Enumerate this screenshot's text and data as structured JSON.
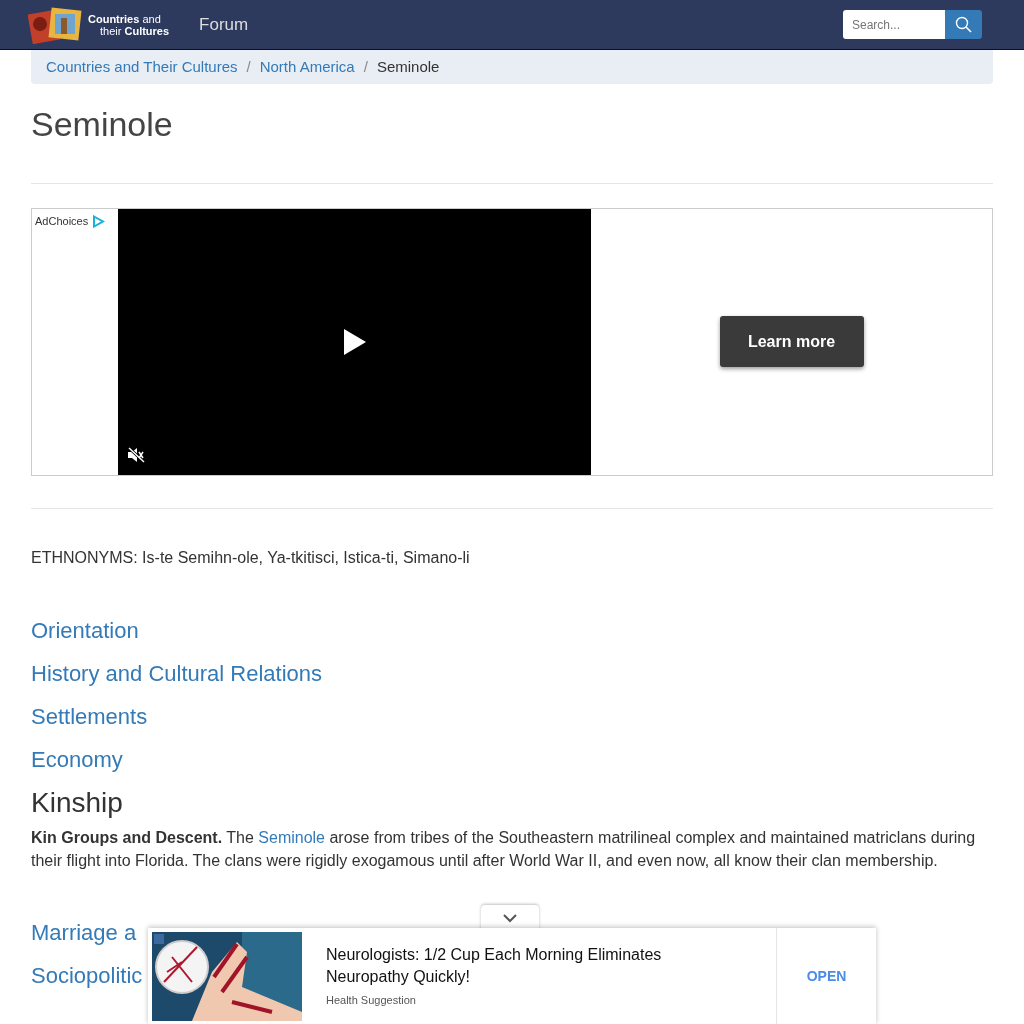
{
  "navbar": {
    "logo_lines": [
      "**Countries** and",
      "their **Cultures**"
    ],
    "links": [
      {
        "label": "Forum"
      }
    ],
    "search": {
      "placeholder": "Search..."
    }
  },
  "breadcrumb_separator": "/",
  "breadcrumb": [
    {
      "label": "Countries and Their Cultures",
      "active": false
    },
    {
      "label": "North America",
      "active": false
    },
    {
      "label": "Seminole",
      "active": true
    }
  ],
  "title": "Seminole",
  "video_ad": {
    "adchoices": "AdChoices",
    "button": "Learn more"
  },
  "ethnonyms": "ETHNONYMS: Is-te Semihn-ole, Ya-tkitisci, Istica-ti, Simano-li",
  "sections": [
    {
      "title": "Orientation",
      "kind": "link"
    },
    {
      "title": "History and Cultural Relations",
      "kind": "link"
    },
    {
      "title": "Settlements",
      "kind": "link"
    },
    {
      "title": "Economy",
      "kind": "link"
    },
    {
      "title": "Kinship",
      "kind": "heading",
      "paragraph": {
        "lead": "Kin Groups and Descent.",
        "before": " The ",
        "link": "Seminole",
        "after": " arose from tribes of the Southeastern matrilineal complex and maintained matriclans during their flight into Florida. The clans were rigidly exogamous until after World War II, and even now, all know their clan membership."
      }
    },
    {
      "title": "Marriage a",
      "kind": "link"
    },
    {
      "title": "Sociopolitic",
      "kind": "link"
    }
  ],
  "bottom_ad": {
    "headline": "Neurologists: 1/2 Cup Each Morning Eliminates Neuropathy Quickly!",
    "source": "Health Suggestion",
    "button": "OPEN"
  }
}
